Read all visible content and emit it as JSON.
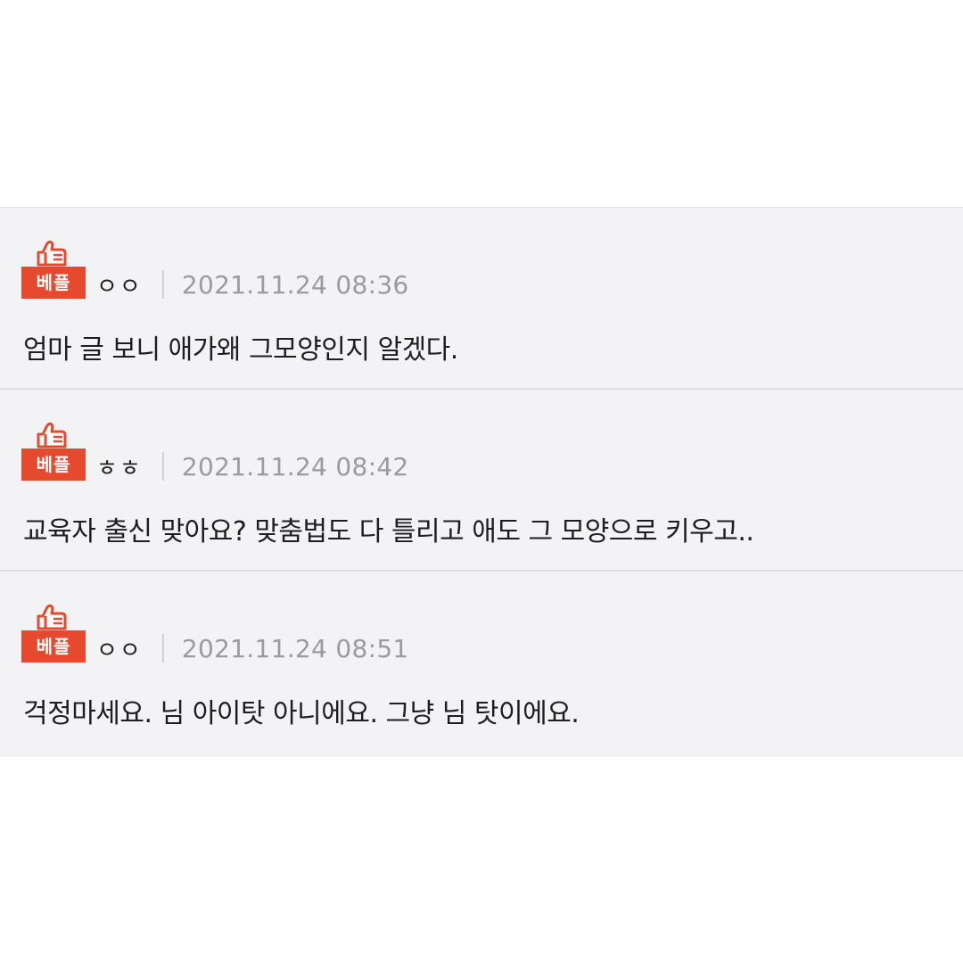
{
  "colors": {
    "badge_red": "#e64a2e",
    "panel_bg": "#f3f3f5",
    "date_gray": "#9b9b9b"
  },
  "comments": [
    {
      "badge_icon": "thumbs-up-icon",
      "badge": "베플",
      "author": "ㅇㅇ",
      "date": "2021.11.24 08:36",
      "text": "엄마 글 보니 애가왜 그모양인지 알겠다."
    },
    {
      "badge_icon": "thumbs-up-icon",
      "badge": "베플",
      "author": "ㅎㅎ",
      "date": "2021.11.24 08:42",
      "text": "교육자 출신 맞아요? 맞춤법도 다 틀리고 애도 그 모양으로 키우고.."
    },
    {
      "badge_icon": "thumbs-up-icon",
      "badge": "베플",
      "author": "ㅇㅇ",
      "date": "2021.11.24 08:51",
      "text": "걱정마세요. 님 아이탓 아니에요. 그냥 님 탓이에요."
    }
  ]
}
